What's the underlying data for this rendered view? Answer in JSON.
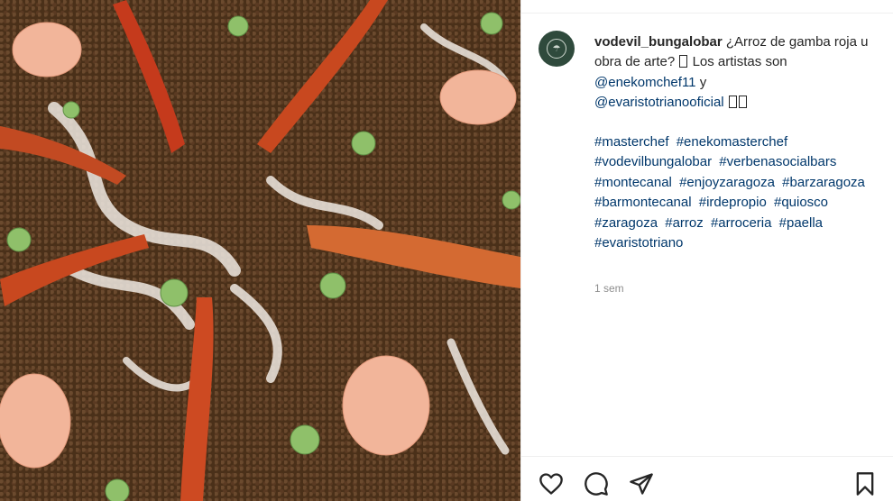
{
  "post": {
    "username": "vodevil_bungalobar",
    "caption_text": "¿Arroz de gamba roja u obra de arte?",
    "caption_after_glyph": "Los artistas son",
    "mention_1": "@enekomchef11",
    "connector": "y",
    "mention_2": "@evaristotrianooficial",
    "hashtags": [
      "#masterchef",
      "#enekomasterchef",
      "#vodevilbungalobar",
      "#verbenasocialbars",
      "#montecanal",
      "#enjoyzaragoza",
      "#barzaragoza",
      "#barmontecanal",
      "#irdepropio",
      "#quiosco",
      "#zaragoza",
      "#arroz",
      "#arroceria",
      "#paella",
      "#evaristotriano"
    ],
    "timestamp": "1 sem"
  },
  "icons": {
    "like": "heart-icon",
    "comment": "comment-icon",
    "share": "share-icon",
    "save": "bookmark-icon"
  },
  "colors": {
    "avatar_bg": "#2f4a3c",
    "link": "#00376b",
    "muted": "#8e8e8e",
    "text": "#262626"
  }
}
